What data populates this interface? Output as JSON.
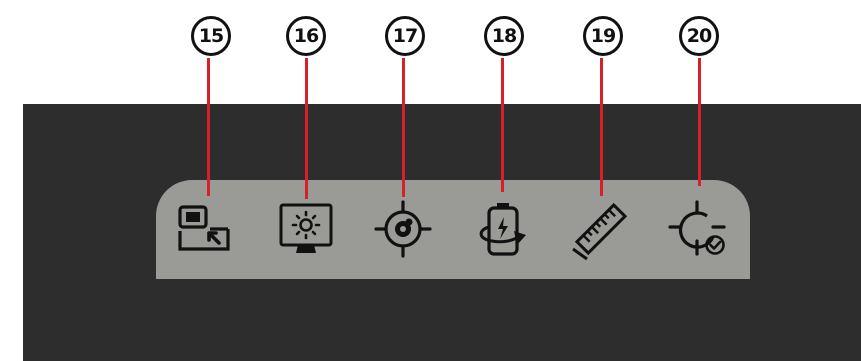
{
  "callouts": [
    {
      "number": "15",
      "tool": "picture-in-picture"
    },
    {
      "number": "16",
      "tool": "screen-brightness"
    },
    {
      "number": "17",
      "tool": "target-lock"
    },
    {
      "number": "18",
      "tool": "battery-rotate"
    },
    {
      "number": "19",
      "tool": "ruler-measure"
    },
    {
      "number": "20",
      "tool": "crosshair-confirm"
    }
  ],
  "colors": {
    "panel": "#2d2d2d",
    "toolbar": "#9a9a96",
    "icon": "#111111",
    "leader_line": "#d8202a"
  }
}
